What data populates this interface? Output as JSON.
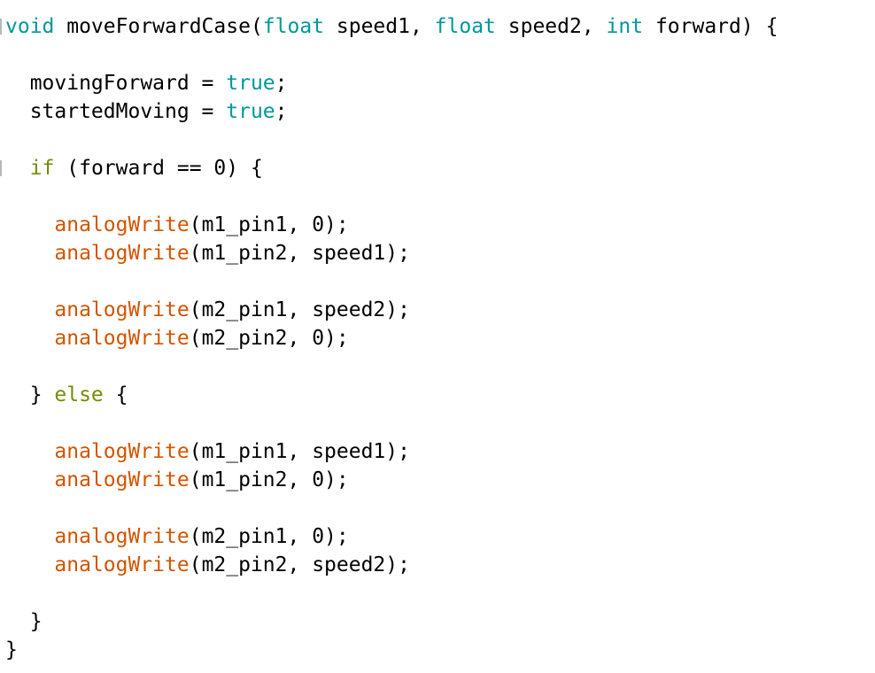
{
  "editor": {
    "language": "arduino",
    "colors": {
      "type_keyword": "#00979c",
      "control_keyword": "#728e00",
      "literal": "#00979c",
      "function": "#d35400",
      "text": "#000000",
      "background": "#ffffff"
    },
    "lines": [
      [
        {
          "t": "void",
          "c": "kw-type"
        },
        {
          "t": " moveForwardCase(",
          "c": "plain"
        },
        {
          "t": "float",
          "c": "kw-type"
        },
        {
          "t": " speed1, ",
          "c": "plain"
        },
        {
          "t": "float",
          "c": "kw-type"
        },
        {
          "t": " speed2, ",
          "c": "plain"
        },
        {
          "t": "int",
          "c": "kw-type"
        },
        {
          "t": " forward) {",
          "c": "plain"
        }
      ],
      [],
      [
        {
          "t": "  movingForward = ",
          "c": "plain"
        },
        {
          "t": "true",
          "c": "kw-lit"
        },
        {
          "t": ";",
          "c": "plain"
        }
      ],
      [
        {
          "t": "  startedMoving = ",
          "c": "plain"
        },
        {
          "t": "true",
          "c": "kw-lit"
        },
        {
          "t": ";",
          "c": "plain"
        }
      ],
      [],
      [
        {
          "t": "  ",
          "c": "plain"
        },
        {
          "t": "if",
          "c": "kw-ctrl"
        },
        {
          "t": " (forward == 0) {",
          "c": "plain"
        }
      ],
      [],
      [
        {
          "t": "    ",
          "c": "plain"
        },
        {
          "t": "analogWrite",
          "c": "fn"
        },
        {
          "t": "(m1_pin1, 0);",
          "c": "plain"
        }
      ],
      [
        {
          "t": "    ",
          "c": "plain"
        },
        {
          "t": "analogWrite",
          "c": "fn"
        },
        {
          "t": "(m1_pin2, speed1);",
          "c": "plain"
        }
      ],
      [],
      [
        {
          "t": "    ",
          "c": "plain"
        },
        {
          "t": "analogWrite",
          "c": "fn"
        },
        {
          "t": "(m2_pin1, speed2);",
          "c": "plain"
        }
      ],
      [
        {
          "t": "    ",
          "c": "plain"
        },
        {
          "t": "analogWrite",
          "c": "fn"
        },
        {
          "t": "(m2_pin2, 0);",
          "c": "plain"
        }
      ],
      [],
      [
        {
          "t": "  } ",
          "c": "plain"
        },
        {
          "t": "else",
          "c": "kw-ctrl"
        },
        {
          "t": " {",
          "c": "plain"
        }
      ],
      [],
      [
        {
          "t": "    ",
          "c": "plain"
        },
        {
          "t": "analogWrite",
          "c": "fn"
        },
        {
          "t": "(m1_pin1, speed1);",
          "c": "plain"
        }
      ],
      [
        {
          "t": "    ",
          "c": "plain"
        },
        {
          "t": "analogWrite",
          "c": "fn"
        },
        {
          "t": "(m1_pin2, 0);",
          "c": "plain"
        }
      ],
      [],
      [
        {
          "t": "    ",
          "c": "plain"
        },
        {
          "t": "analogWrite",
          "c": "fn"
        },
        {
          "t": "(m2_pin1, 0);",
          "c": "plain"
        }
      ],
      [
        {
          "t": "    ",
          "c": "plain"
        },
        {
          "t": "analogWrite",
          "c": "fn"
        },
        {
          "t": "(m2_pin2, speed2);",
          "c": "plain"
        }
      ],
      [],
      [
        {
          "t": "  }",
          "c": "plain"
        }
      ],
      [
        {
          "t": "}",
          "c": "plain"
        }
      ]
    ]
  }
}
